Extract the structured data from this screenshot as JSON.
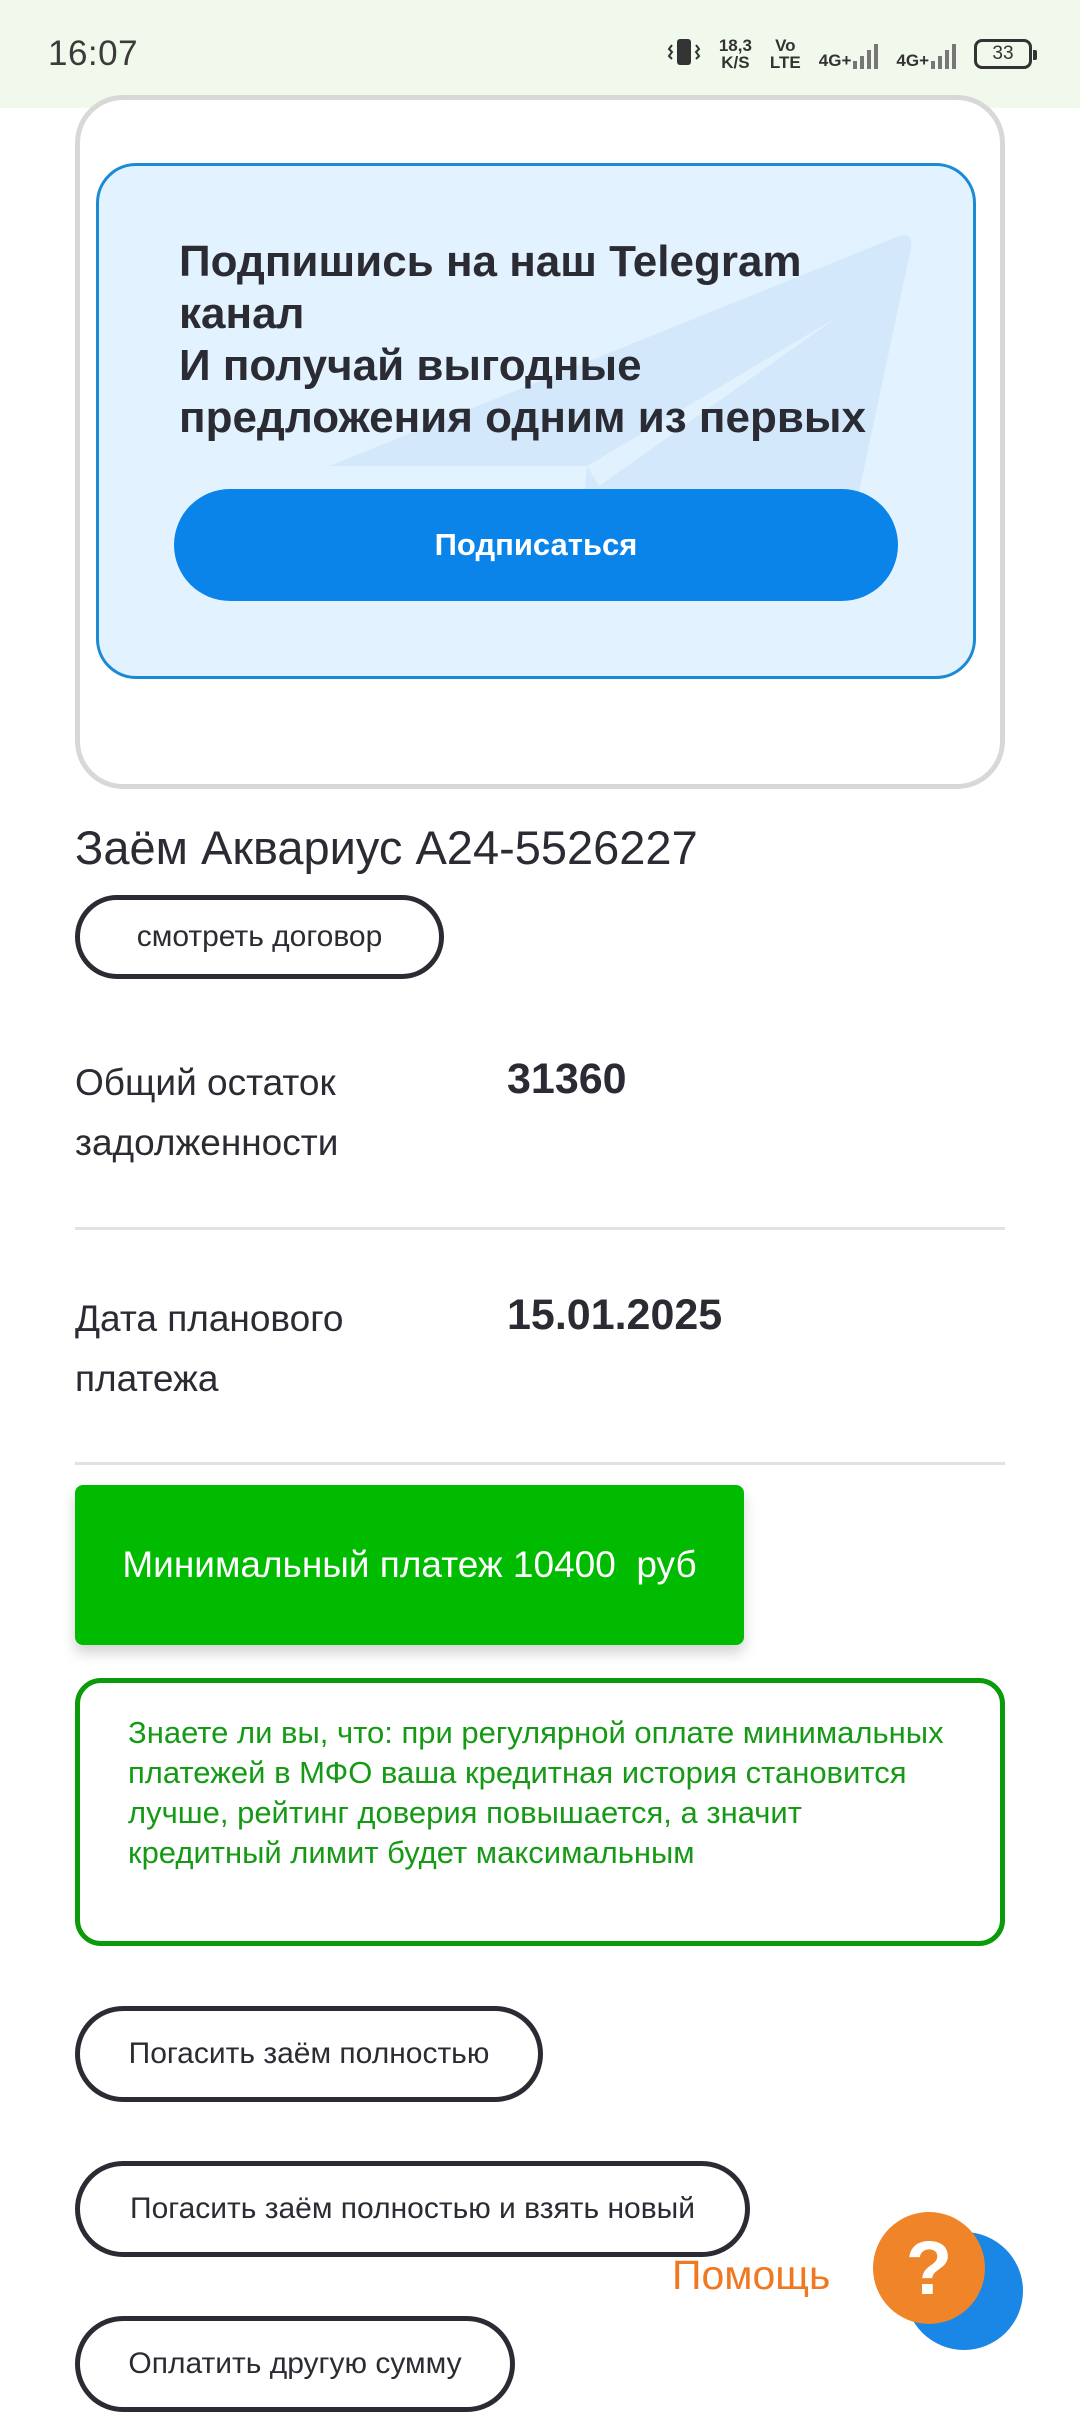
{
  "status_bar": {
    "time": "16:07",
    "net_speed_value": "18,3",
    "net_speed_unit": "K/S",
    "volte_top": "Vo",
    "volte_bottom": "LTE",
    "sim1_type": "4G+",
    "sim2_type": "4G+",
    "battery": "33"
  },
  "telegram_promo": {
    "line1": "Подпишись на наш Telegram\nканал",
    "line2": "И получай выгодные\nпредложения одним из первых",
    "subscribe_label": "Подписаться"
  },
  "loan": {
    "title": "Заём Аквариус A24-5526227",
    "view_contract_label": "смотреть договор",
    "debt_label": "Общий остаток\nзадолженности",
    "debt_value": "31360",
    "date_label": "Дата планового\nплатежа",
    "date_value": "15.01.2025",
    "min_payment_label": "Минимальный платеж 10400  руб",
    "tip_text": "Знаете ли вы, что: при регулярной оплате минимальных платежей в МФО ваша кредитная история становится лучше, рейтинг доверия повышается, а значит кредитный лимит будет максимальным"
  },
  "actions": {
    "pay_full": "Погасить заём полностью",
    "pay_full_new": "Погасить заём полностью и взять новый",
    "pay_other": "Оплатить другую сумму"
  },
  "help": {
    "label": "Помощь",
    "icon_glyph": "?"
  },
  "colors": {
    "accent_blue": "#0a84e9",
    "green": "#00bb00",
    "orange": "#f08428"
  }
}
